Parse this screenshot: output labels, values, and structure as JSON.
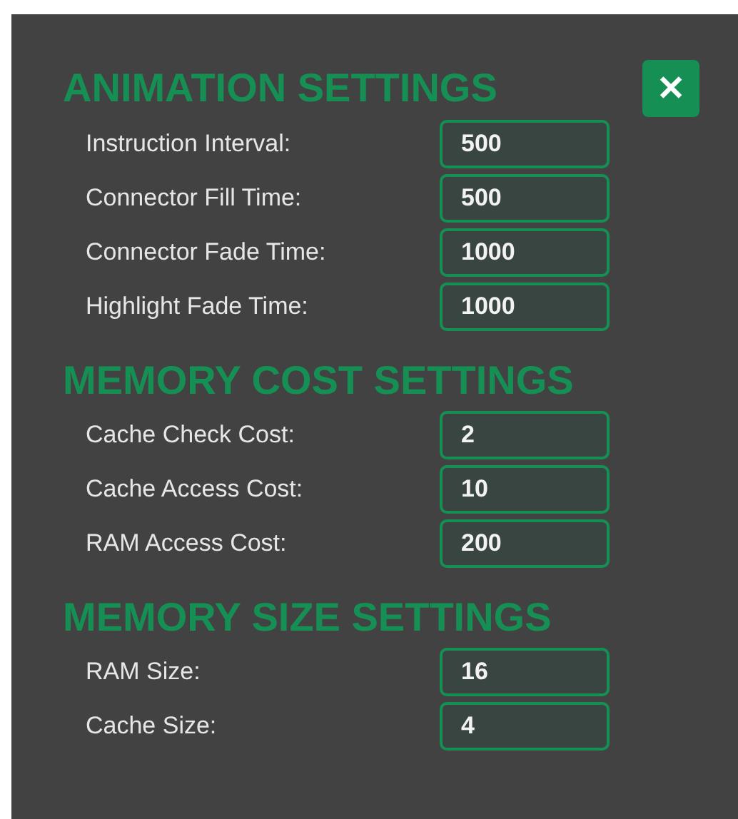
{
  "close_button": {
    "label": "✕"
  },
  "sections": [
    {
      "title": "ANIMATION SETTINGS",
      "fields": [
        {
          "label": "Instruction Interval:",
          "value": "500"
        },
        {
          "label": "Connector Fill Time:",
          "value": "500"
        },
        {
          "label": "Connector Fade Time:",
          "value": "1000"
        },
        {
          "label": "Highlight Fade Time:",
          "value": "1000"
        }
      ]
    },
    {
      "title": "MEMORY COST SETTINGS",
      "fields": [
        {
          "label": "Cache Check Cost:",
          "value": "2"
        },
        {
          "label": "Cache Access Cost:",
          "value": "10"
        },
        {
          "label": "RAM Access Cost:",
          "value": "200"
        }
      ]
    },
    {
      "title": "MEMORY SIZE SETTINGS",
      "fields": [
        {
          "label": "RAM Size:",
          "value": "16"
        },
        {
          "label": "Cache Size:",
          "value": "4"
        }
      ]
    }
  ]
}
